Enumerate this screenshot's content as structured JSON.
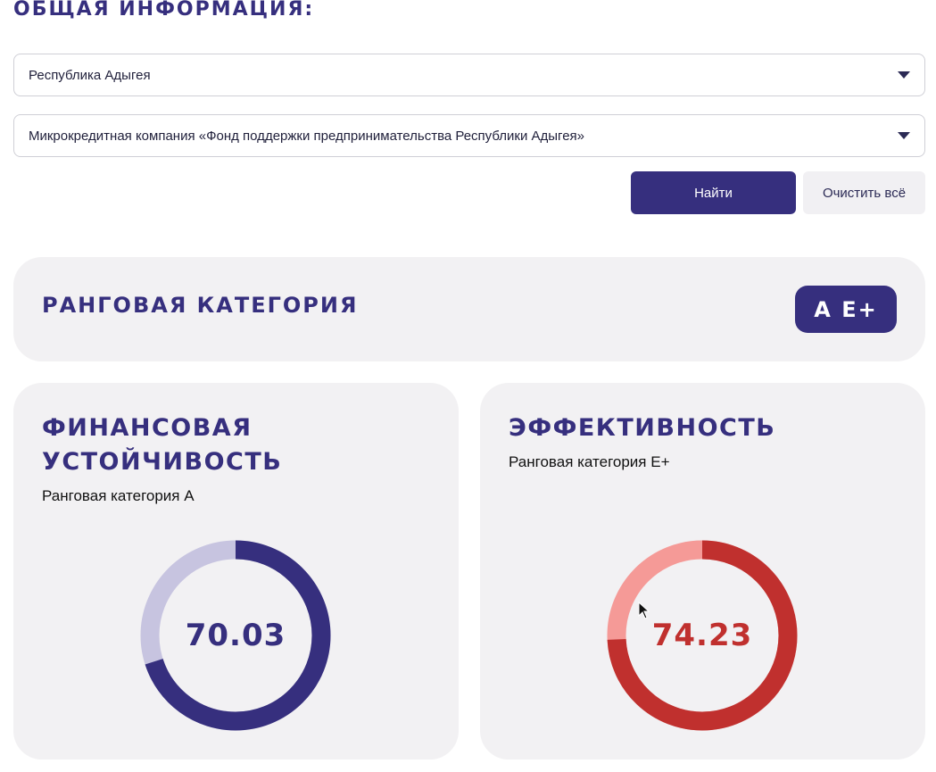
{
  "header": {
    "title": "ОБЩАЯ ИНФОРМАЦИЯ:"
  },
  "filters": {
    "region": "Республика Адыгея",
    "organization": "Микрокредитная компания «Фонд поддержки предпринимательства Республики Адыгея»"
  },
  "buttons": {
    "find": "Найти",
    "clear": "Очистить всё"
  },
  "rank": {
    "title": "РАНГОВАЯ КАТЕГОРИЯ",
    "badge": "А Е+"
  },
  "financial": {
    "title": "ФИНАНСОВАЯ УСТОЙЧИВОСТЬ",
    "subtitle": "Ранговая категория А",
    "value": "70.03",
    "fraction": 0.7003,
    "color_main": "#362f7e",
    "color_rest": "#c7c4e0"
  },
  "efficiency": {
    "title": "ЭФФЕКТИВНОСТЬ",
    "subtitle": "Ранговая категория Е+",
    "value": "74.23",
    "fraction": 0.7423,
    "color_main": "#c0302e",
    "color_rest": "#f59a97"
  }
}
